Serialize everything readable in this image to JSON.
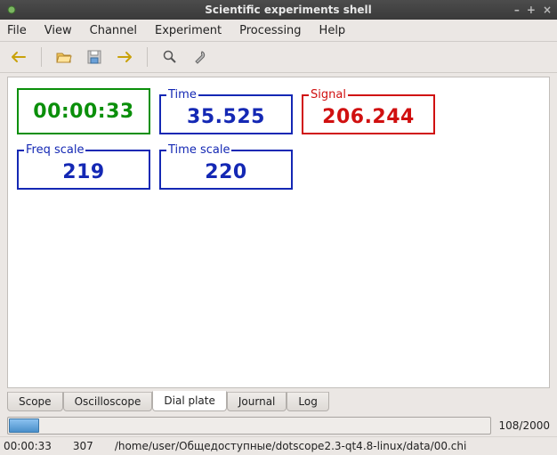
{
  "window": {
    "title": "Scientific experiments shell"
  },
  "menu": {
    "file": "File",
    "view": "View",
    "channel": "Channel",
    "experiment": "Experiment",
    "processing": "Processing",
    "help": "Help"
  },
  "readouts": {
    "elapsed": {
      "label": "",
      "value": "00:00:33"
    },
    "time": {
      "label": "Time",
      "value": "35.525"
    },
    "signal": {
      "label": "Signal",
      "value": "206.244"
    },
    "freq_scale": {
      "label": "Freq scale",
      "value": "219"
    },
    "time_scale": {
      "label": "Time scale",
      "value": "220"
    }
  },
  "tabs": {
    "scope": "Scope",
    "oscilloscope": "Oscilloscope",
    "dial_plate": "Dial plate",
    "journal": "Journal",
    "log": "Log",
    "active": "dial_plate"
  },
  "scroll": {
    "position_label": "108/2000"
  },
  "status": {
    "time": "00:00:33",
    "count": "307",
    "path": "/home/user/Общедоступные/dotscope2.3-qt4.8-linux/data/00.chi"
  }
}
